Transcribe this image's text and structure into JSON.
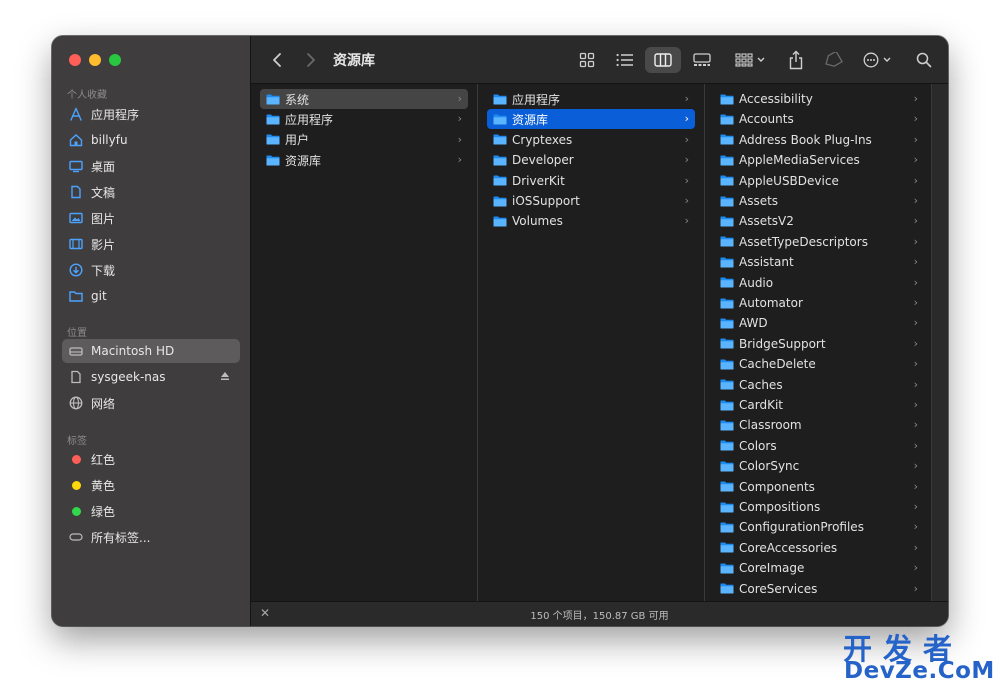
{
  "window": {
    "title": "资源库",
    "accent": "#0a5ed7"
  },
  "sidebar": {
    "favorites_title": "个人收藏",
    "favorites": [
      {
        "label": "应用程序",
        "icon": "applications-icon"
      },
      {
        "label": "billyfu",
        "icon": "home-icon"
      },
      {
        "label": "桌面",
        "icon": "desktop-icon"
      },
      {
        "label": "文稿",
        "icon": "document-icon"
      },
      {
        "label": "图片",
        "icon": "pictures-icon"
      },
      {
        "label": "影片",
        "icon": "movies-icon"
      },
      {
        "label": "下载",
        "icon": "downloads-icon"
      },
      {
        "label": "git",
        "icon": "folder-icon"
      }
    ],
    "locations_title": "位置",
    "locations": [
      {
        "label": "Macintosh HD",
        "icon": "hard-drive-icon",
        "selected": true
      },
      {
        "label": "sysgeek-nas",
        "icon": "server-icon"
      },
      {
        "label": "网络",
        "icon": "network-icon"
      }
    ],
    "tags_title": "标签",
    "tags": [
      {
        "label": "红色",
        "color": "#ff5f57"
      },
      {
        "label": "黄色",
        "color": "#ffd60a"
      },
      {
        "label": "绿色",
        "color": "#32d74b"
      },
      {
        "label": "所有标签...",
        "icon": "tag-icon"
      }
    ]
  },
  "columns": [
    {
      "items": [
        "系统",
        "应用程序",
        "用户",
        "资源库"
      ],
      "selected": 0,
      "selected_style": "gray"
    },
    {
      "items": [
        "应用程序",
        "资源库",
        "Cryptexes",
        "Developer",
        "DriverKit",
        "iOSSupport",
        "Volumes"
      ],
      "selected": 1,
      "selected_style": "blue"
    },
    {
      "items": [
        "Accessibility",
        "Accounts",
        "Address Book Plug-Ins",
        "AppleMediaServices",
        "AppleUSBDevice",
        "Assets",
        "AssetsV2",
        "AssetTypeDescriptors",
        "Assistant",
        "Audio",
        "Automator",
        "AWD",
        "BridgeSupport",
        "CacheDelete",
        "Caches",
        "CardKit",
        "Classroom",
        "Colors",
        "ColorSync",
        "Components",
        "Compositions",
        "ConfigurationProfiles",
        "CoreAccessories",
        "CoreImage",
        "CoreServices"
      ],
      "selected": -1,
      "selected_style": "none"
    }
  ],
  "statusbar": {
    "text": "150 个项目，150.87 GB 可用",
    "close": "✕"
  },
  "watermark": {
    "cn": "开发者",
    "en": "DevZe.CoM"
  }
}
